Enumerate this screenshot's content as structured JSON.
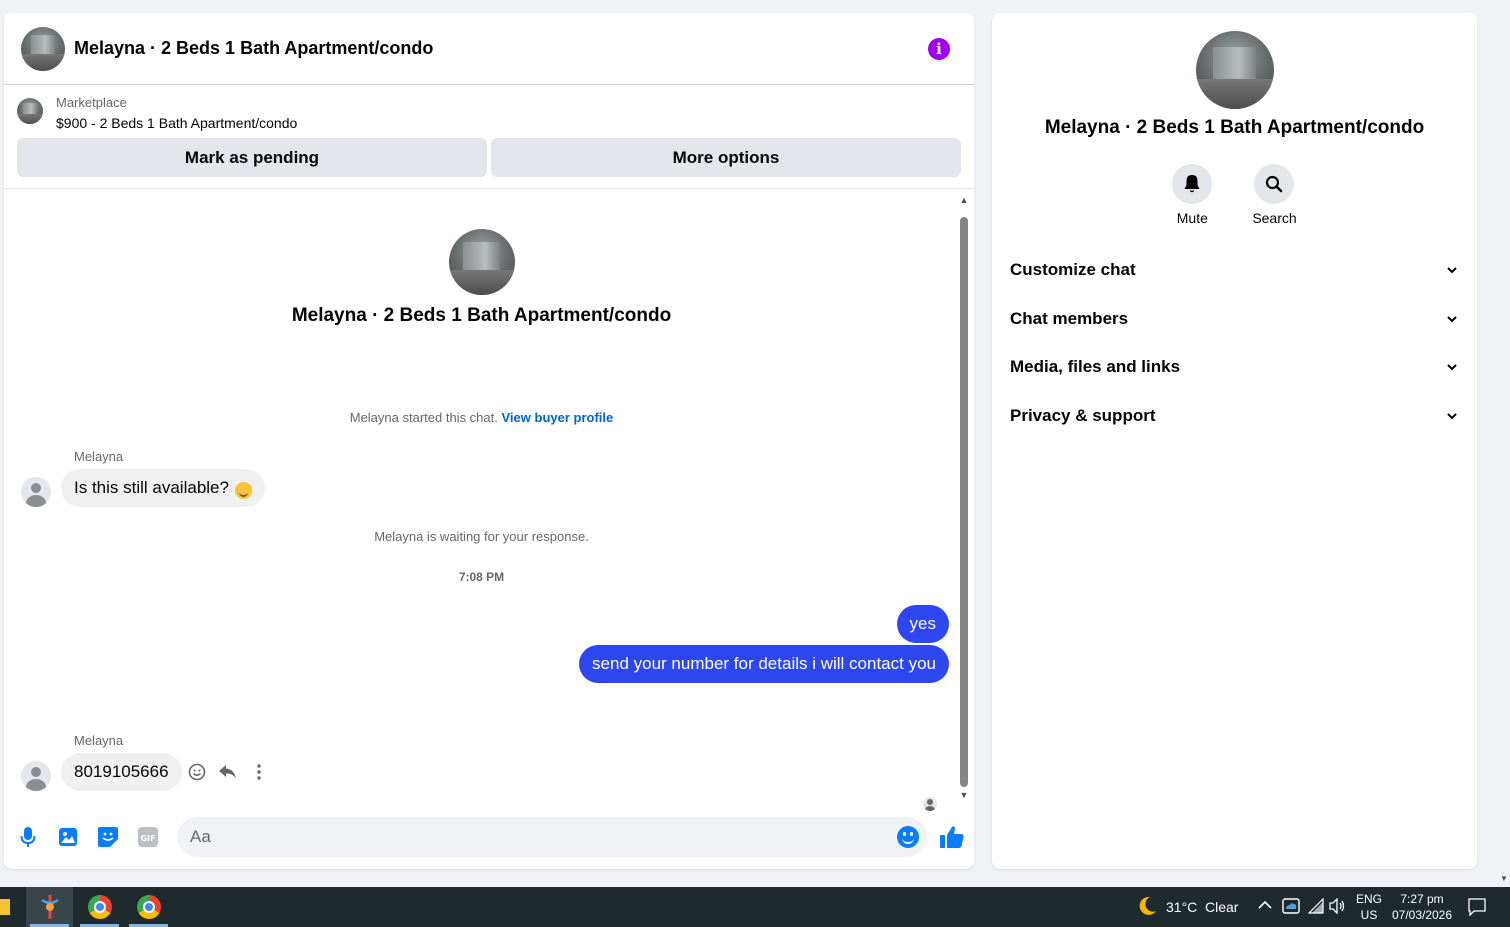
{
  "chat": {
    "title": "Melayna · 2 Beds 1 Bath Apartment/condo",
    "info_icon": "i"
  },
  "marketplace": {
    "label": "Marketplace",
    "listing": "$900 - 2 Beds 1 Bath Apartment/condo",
    "pending_button": "Mark as pending",
    "more_button": "More options"
  },
  "intro": {
    "title": "Melayna · 2 Beds 1 Bath Apartment/condo",
    "started_text": "Melayna started this chat.",
    "profile_link": "View buyer profile"
  },
  "messages": {
    "sender_1": "Melayna",
    "incoming_1": "Is this still available?",
    "waiting_text": "Melayna is waiting for your response.",
    "timestamp": "7:08 PM",
    "outgoing_1": "yes",
    "outgoing_2": "send your number for details i will contact you",
    "sender_2": "Melayna",
    "incoming_2": "8019105666"
  },
  "composer": {
    "placeholder": "Aa"
  },
  "info_panel": {
    "title": "Melayna · 2 Beds 1 Bath Apartment/condo",
    "mute_label": "Mute",
    "search_label": "Search",
    "sections": [
      "Customize chat",
      "Chat members",
      "Media, files and links",
      "Privacy & support"
    ]
  },
  "taskbar": {
    "weather_temp": "31°C",
    "weather_desc": "Clear",
    "lang_1": "ENG",
    "lang_2": "US",
    "time": "7:27 pm",
    "date": "07/03/2026"
  },
  "colors": {
    "accent": "#0064d1",
    "outgoing_bubble": "#2e46f0",
    "info_icon": "#a200f2",
    "messenger_blue": "#0a7cff"
  }
}
